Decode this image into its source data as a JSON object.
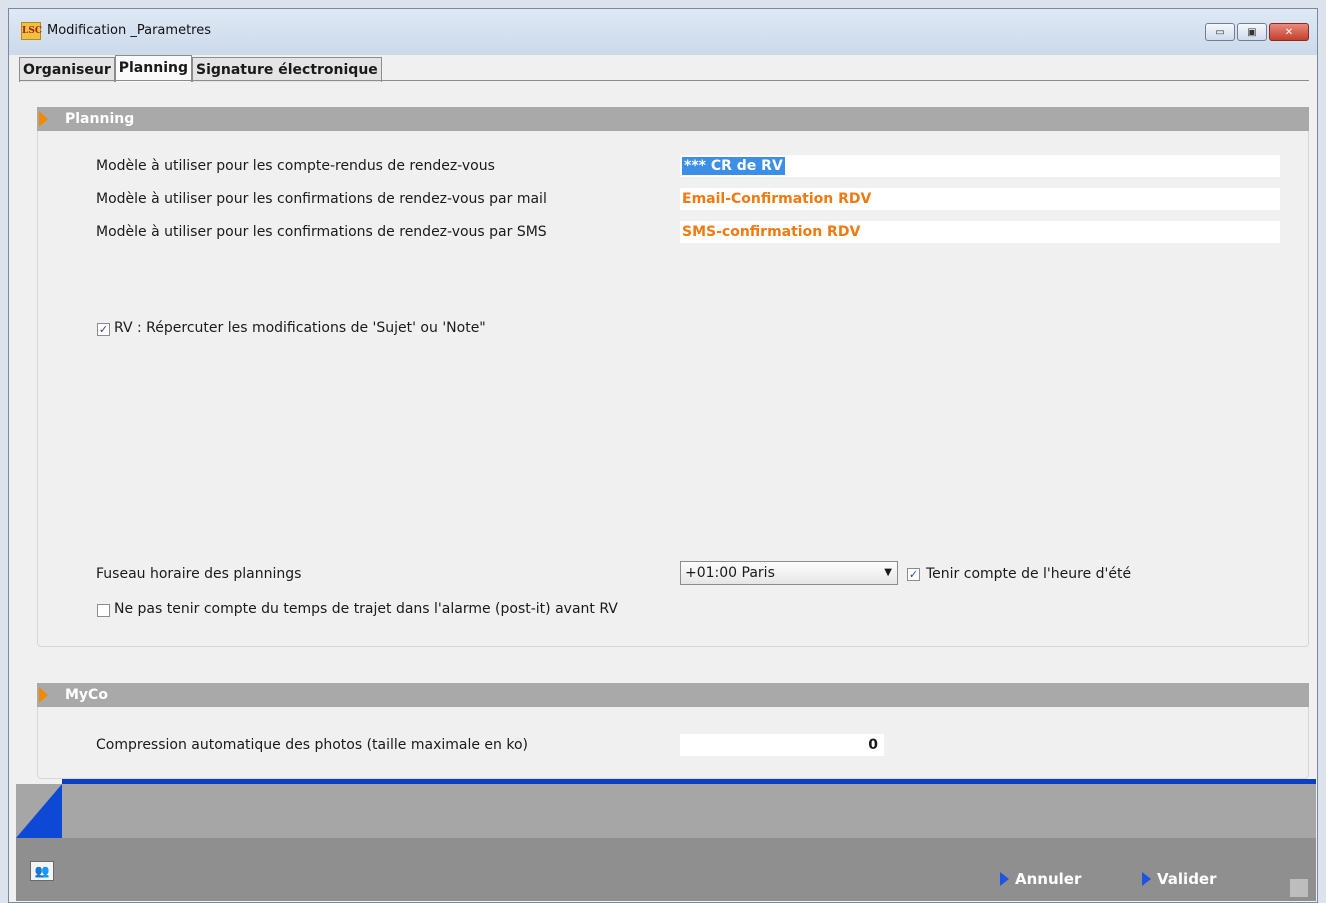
{
  "window": {
    "logo": "LSC",
    "title": "Modification _Parametres",
    "minimize_glyph": "▭",
    "maximize_glyph": "▣",
    "close_glyph": "✕"
  },
  "tabs": [
    {
      "label": "Organiseur",
      "active": false
    },
    {
      "label": "Planning",
      "active": true
    },
    {
      "label": "Signature électronique",
      "active": false
    }
  ],
  "planning": {
    "header": "Planning",
    "rows": [
      {
        "label": "Modèle à utiliser pour les compte-rendus de rendez-vous",
        "value": "*** CR de RV"
      },
      {
        "label": "Modèle à utiliser pour les confirmations de rendez-vous par mail",
        "value": "Email-Confirmation RDV"
      },
      {
        "label": "Modèle à utiliser pour les confirmations de rendez-vous par SMS",
        "value": "SMS-confirmation RDV"
      }
    ],
    "repercuter": {
      "label": "RV : Répercuter les modifications de 'Sujet' ou 'Note\"",
      "checked": true
    },
    "timezone": {
      "label": "Fuseau horaire des plannings",
      "value": "+01:00 Paris"
    },
    "summer_time": {
      "label": "Tenir compte de l'heure d'été",
      "checked": true
    },
    "trajet": {
      "label": "Ne pas tenir compte du temps de trajet dans l'alarme (post-it) avant RV",
      "checked": false
    }
  },
  "myco": {
    "header": "MyCo",
    "compression": {
      "label": "Compression automatique des photos (taille maximale en ko)",
      "value": "0"
    }
  },
  "footer": {
    "users_icon": "users-icon",
    "cancel_label": "Annuler",
    "validate_label": "Valider"
  },
  "colors": {
    "accent_orange": "#f07a10",
    "section_gray": "#a9a9a9",
    "brand_blue": "#0e49d6",
    "selection_blue": "#3c8ee6"
  }
}
